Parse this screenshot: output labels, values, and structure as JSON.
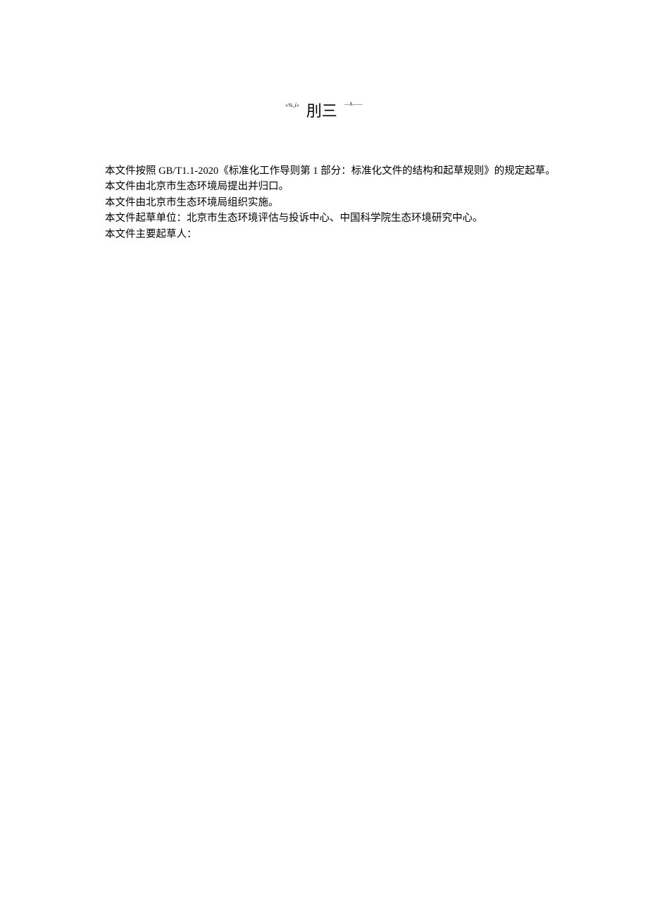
{
  "heading": {
    "scribble_left": "»%‚í»",
    "main": "刖三",
    "scribble_right": "—A——"
  },
  "paragraphs": [
    "本文件按照 GB/T1.1-2020《标准化工作导则第 1 部分：标准化文件的结构和起草规则》的规定起草。",
    "本文件由北京市生态环境局提出并归口。",
    "本文件由北京市生态环境局组织实施。",
    "本文件起草单位：北京市生态环境评估与投诉中心、中国科学院生态环境研究中心。",
    "本文件主要起草人："
  ]
}
